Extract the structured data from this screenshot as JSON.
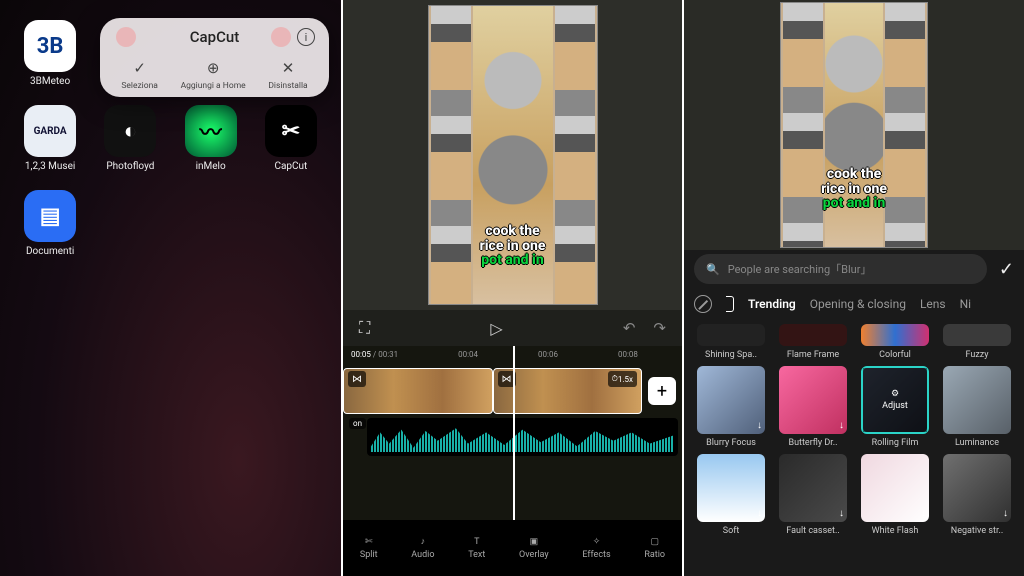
{
  "panel1": {
    "apps": {
      "meteo": {
        "label": "3BMeteo",
        "text": "3B"
      },
      "musei": {
        "label": "1,2,3 Musei"
      },
      "photo": {
        "label": "Photofloyd"
      },
      "inmelo": {
        "label": "inMelo"
      },
      "capcut": {
        "label": "CapCut"
      },
      "docs": {
        "label": "Documenti"
      }
    },
    "context": {
      "title": "CapCut",
      "select": "Seleziona",
      "add": "Aggiungi a Home",
      "uninstall": "Disinstalla"
    }
  },
  "panel2": {
    "caption": {
      "l1": "cook the",
      "l2": "rice in one",
      "l3": "pot and in"
    },
    "time": {
      "now": "00:05",
      "total": "00:31",
      "t1": "00:04",
      "t2": "00:06",
      "t3": "00:08"
    },
    "speed_badge": "1.5x",
    "track_label": "on",
    "tools": {
      "split": "Split",
      "audio": "Audio",
      "text": "Text",
      "overlay": "Overlay",
      "effects": "Effects",
      "ratio": "Ratio"
    }
  },
  "panel3": {
    "caption": {
      "l1": "cook the",
      "l2": "rice in one",
      "l3": "pot and in"
    },
    "search_placeholder": "People are searching「Blur」",
    "tabs": {
      "trending": "Trending",
      "opening": "Opening & closing",
      "lens": "Lens",
      "ni": "Ni"
    },
    "effects_row0": [
      "Shining Spa..",
      "Flame Frame",
      "Colorful",
      "Fuzzy"
    ],
    "effects_row1": [
      "Blurry Focus",
      "Butterfly Dr..",
      "Rolling Film",
      "Luminance"
    ],
    "effects_row2": [
      "Soft",
      "Fault casset..",
      "White Flash",
      "Negative str.."
    ],
    "adjust_label": "Adjust"
  }
}
